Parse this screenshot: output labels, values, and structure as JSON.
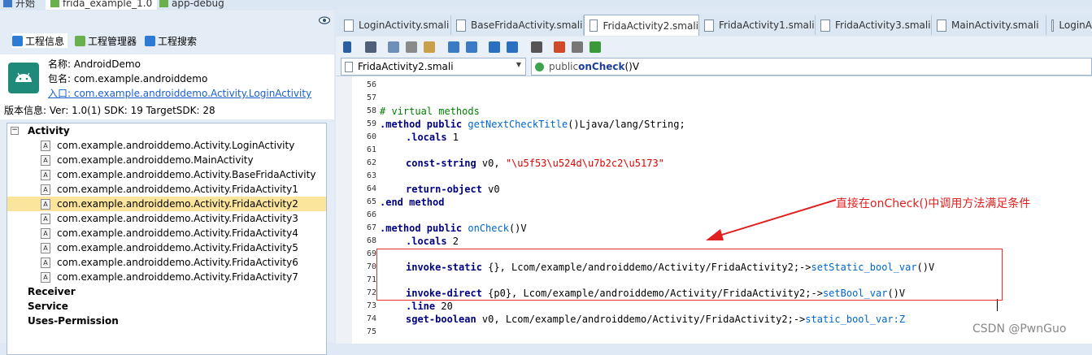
{
  "top_tabs": [
    "开始",
    "frida_example_1.0",
    "app-debug"
  ],
  "left_tabs": [
    "工程信息",
    "工程管理器",
    "工程搜索"
  ],
  "info": {
    "name": "名称: AndroidDemo",
    "package": "包名: com.example.androiddemo",
    "entry_label": "入口: ",
    "entry_value": "com.example.androiddemo.Activity.LoginActivity",
    "version": "版本信息: Ver: 1.0(1) SDK: 19 TargetSDK: 28"
  },
  "tree": {
    "root": "Activity",
    "activities": [
      "com.example.androiddemo.Activity.LoginActivity",
      "com.example.androiddemo.MainActivity",
      "com.example.androiddemo.Activity.BaseFridaActivity",
      "com.example.androiddemo.Activity.FridaActivity1",
      "com.example.androiddemo.Activity.FridaActivity2",
      "com.example.androiddemo.Activity.FridaActivity3",
      "com.example.androiddemo.Activity.FridaActivity4",
      "com.example.androiddemo.Activity.FridaActivity5",
      "com.example.androiddemo.Activity.FridaActivity6",
      "com.example.androiddemo.Activity.FridaActivity7"
    ],
    "selected_index": 4,
    "others": [
      "Receiver",
      "Service",
      "Uses-Permission"
    ]
  },
  "editor_tabs": [
    "LoginActivity.smali",
    "BaseFridaActivity.smali",
    "FridaActivity2.smali",
    "FridaActivity1.smali",
    "FridaActivity3.smali",
    "MainActivity.smali",
    "LoginA"
  ],
  "file_combo": "FridaActivity2.smali",
  "method_combo": {
    "prefix": "public ",
    "name": "onCheck",
    "suffix": "()V"
  },
  "code": {
    "line_numbers": [
      "56",
      "57",
      "58",
      "59",
      "60",
      "61",
      "62",
      "63",
      "64",
      "65",
      "66",
      "67",
      "68",
      "69",
      "70",
      "71",
      "72",
      "73",
      "74",
      "75"
    ],
    "l58": "# virtual methods",
    "l59_kw": ".method public ",
    "l59_fn": "getNextCheckTitle",
    "l59_rest": "()Ljava/lang/String;",
    "l60_kw": ".locals",
    "l60_rest": " 1",
    "l62_kw": "const-string",
    "l62_rest": " v0, ",
    "l62_str": "\"\\u5f53\\u524d\\u7b2c2\\u5173\"",
    "l64_kw": "return-object",
    "l64_rest": " v0",
    "l65_kw": ".end method",
    "l67_kw": ".method public ",
    "l67_fn": "onCheck",
    "l67_rest": "()V",
    "l68_kw": ".locals",
    "l68_rest": " 2",
    "l70_kw": "invoke-static",
    "l70_rest": " {}, Lcom/example/androiddemo/Activity/FridaActivity2;->",
    "l70_fn": "setStatic_bool_var",
    "l70_tail": "()V",
    "l72_kw": "invoke-direct",
    "l72_rest": " {p0}, Lcom/example/androiddemo/Activity/FridaActivity2;->",
    "l72_fn": "setBool_var",
    "l72_tail": "()V",
    "l73_kw": ".line",
    "l73_rest": " 20",
    "l74_kw": "sget-boolean",
    "l74_rest": " v0, Lcom/example/androiddemo/Activity/FridaActivity2;->",
    "l74_fn": "static_bool_var:Z"
  },
  "annotation": "直接在onCheck()中调用方法满足条件",
  "watermark": "CSDN @PwnGuo"
}
